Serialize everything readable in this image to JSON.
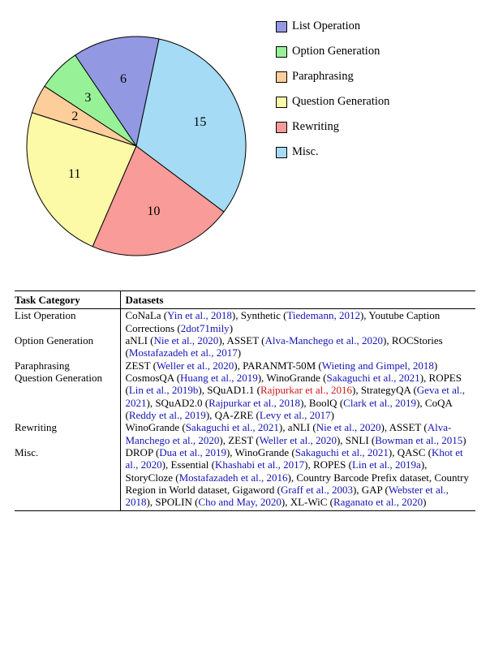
{
  "chart_data": {
    "type": "pie",
    "title": "",
    "series": [
      {
        "name": "List Operation",
        "value": 6,
        "color": "#9398e2"
      },
      {
        "name": "Option Generation",
        "value": 3,
        "color": "#97f297"
      },
      {
        "name": "Paraphrasing",
        "value": 2,
        "color": "#fdcd9a"
      },
      {
        "name": "Question Generation",
        "value": 11,
        "color": "#fcf9a7"
      },
      {
        "name": "Rewriting",
        "value": 10,
        "color": "#f99b98"
      },
      {
        "name": "Misc.",
        "value": 15,
        "color": "#a5dbf4"
      }
    ],
    "legend_position": "right"
  },
  "legend": {
    "items": [
      {
        "label": "List Operation",
        "color": "#9398e2"
      },
      {
        "label": "Option Generation",
        "color": "#97f297"
      },
      {
        "label": "Paraphrasing",
        "color": "#fdcd9a"
      },
      {
        "label": "Question Generation",
        "color": "#fcf9a7"
      },
      {
        "label": "Rewriting",
        "color": "#f99b98"
      },
      {
        "label": "Misc.",
        "color": "#a5dbf4"
      }
    ]
  },
  "table": {
    "header": {
      "category": "Task Category",
      "datasets": "Datasets"
    },
    "rows": [
      {
        "category": "List Operation",
        "datasets_html": "CoNaLa (<span class='cite'>Yin et al., 2018</span>), Synthetic (<span class='cite'>Tiedemann, 2012</span>), Youtube Caption Corrections (<span class='cite'>2dot71mily</span>)"
      },
      {
        "category": "Option Generation",
        "datasets_html": "aNLI (<span class='cite'>Nie et al., 2020</span>), ASSET (<span class='cite'>Alva-Manchego et al., 2020</span>), ROCStories (<span class='cite'>Mostafazadeh et al., 2017</span>)"
      },
      {
        "category": "Paraphrasing",
        "datasets_html": "ZEST (<span class='cite'>Weller et al., 2020</span>), PARANMT-50M (<span class='cite'>Wieting and Gimpel, 2018</span>)"
      },
      {
        "category": "Question Generation",
        "datasets_html": "CosmosQA (<span class='cite'>Huang et al., 2019</span>), WinoGrande (<span class='cite'>Sakaguchi et al., 2021</span>), ROPES (<span class='cite'>Lin et al., 2019b</span>), SQuAD1.1 (<span class='citeR'>Rajpurkar et al., 2016</span>), StrategyQA (<span class='cite'>Geva et al., 2021</span>), SQuAD2.0 (<span class='cite'>Rajpurkar et al., 2018</span>), BoolQ (<span class='cite'>Clark et al., 2019</span>), CoQA (<span class='cite'>Reddy et al., 2019</span>), QA-ZRE (<span class='cite'>Levy et al., 2017</span>)"
      },
      {
        "category": "Rewriting",
        "datasets_html": "WinoGrande (<span class='cite'>Sakaguchi et al., 2021</span>), aNLI (<span class='cite'>Nie et al., 2020</span>), ASSET (<span class='cite'>Alva-Manchego et al., 2020</span>), ZEST (<span class='cite'>Weller et al., 2020</span>), SNLI (<span class='cite'>Bowman et al., 2015</span>)"
      },
      {
        "category": "Misc.",
        "datasets_html": "DROP (<span class='cite'>Dua et al., 2019</span>), WinoGrande (<span class='cite'>Sakaguchi et al., 2021</span>), QASC (<span class='cite'>Khot et al., 2020</span>), Essential (<span class='cite'>Khashabi et al., 2017</span>), ROPES (<span class='cite'>Lin et al., 2019a</span>), StoryCloze (<span class='cite'>Mostafazadeh et al., 2016</span>), Country Barcode Prefix dataset, Country Region in World dataset, Gigaword (<span class='cite'>Graff et al., 2003</span>), GAP (<span class='cite'>Webster et al., 2018</span>), SPOLIN (<span class='cite'>Cho and May, 2020</span>), XL-WiC (<span class='cite'>Raganato et al., 2020</span>)"
      }
    ]
  }
}
